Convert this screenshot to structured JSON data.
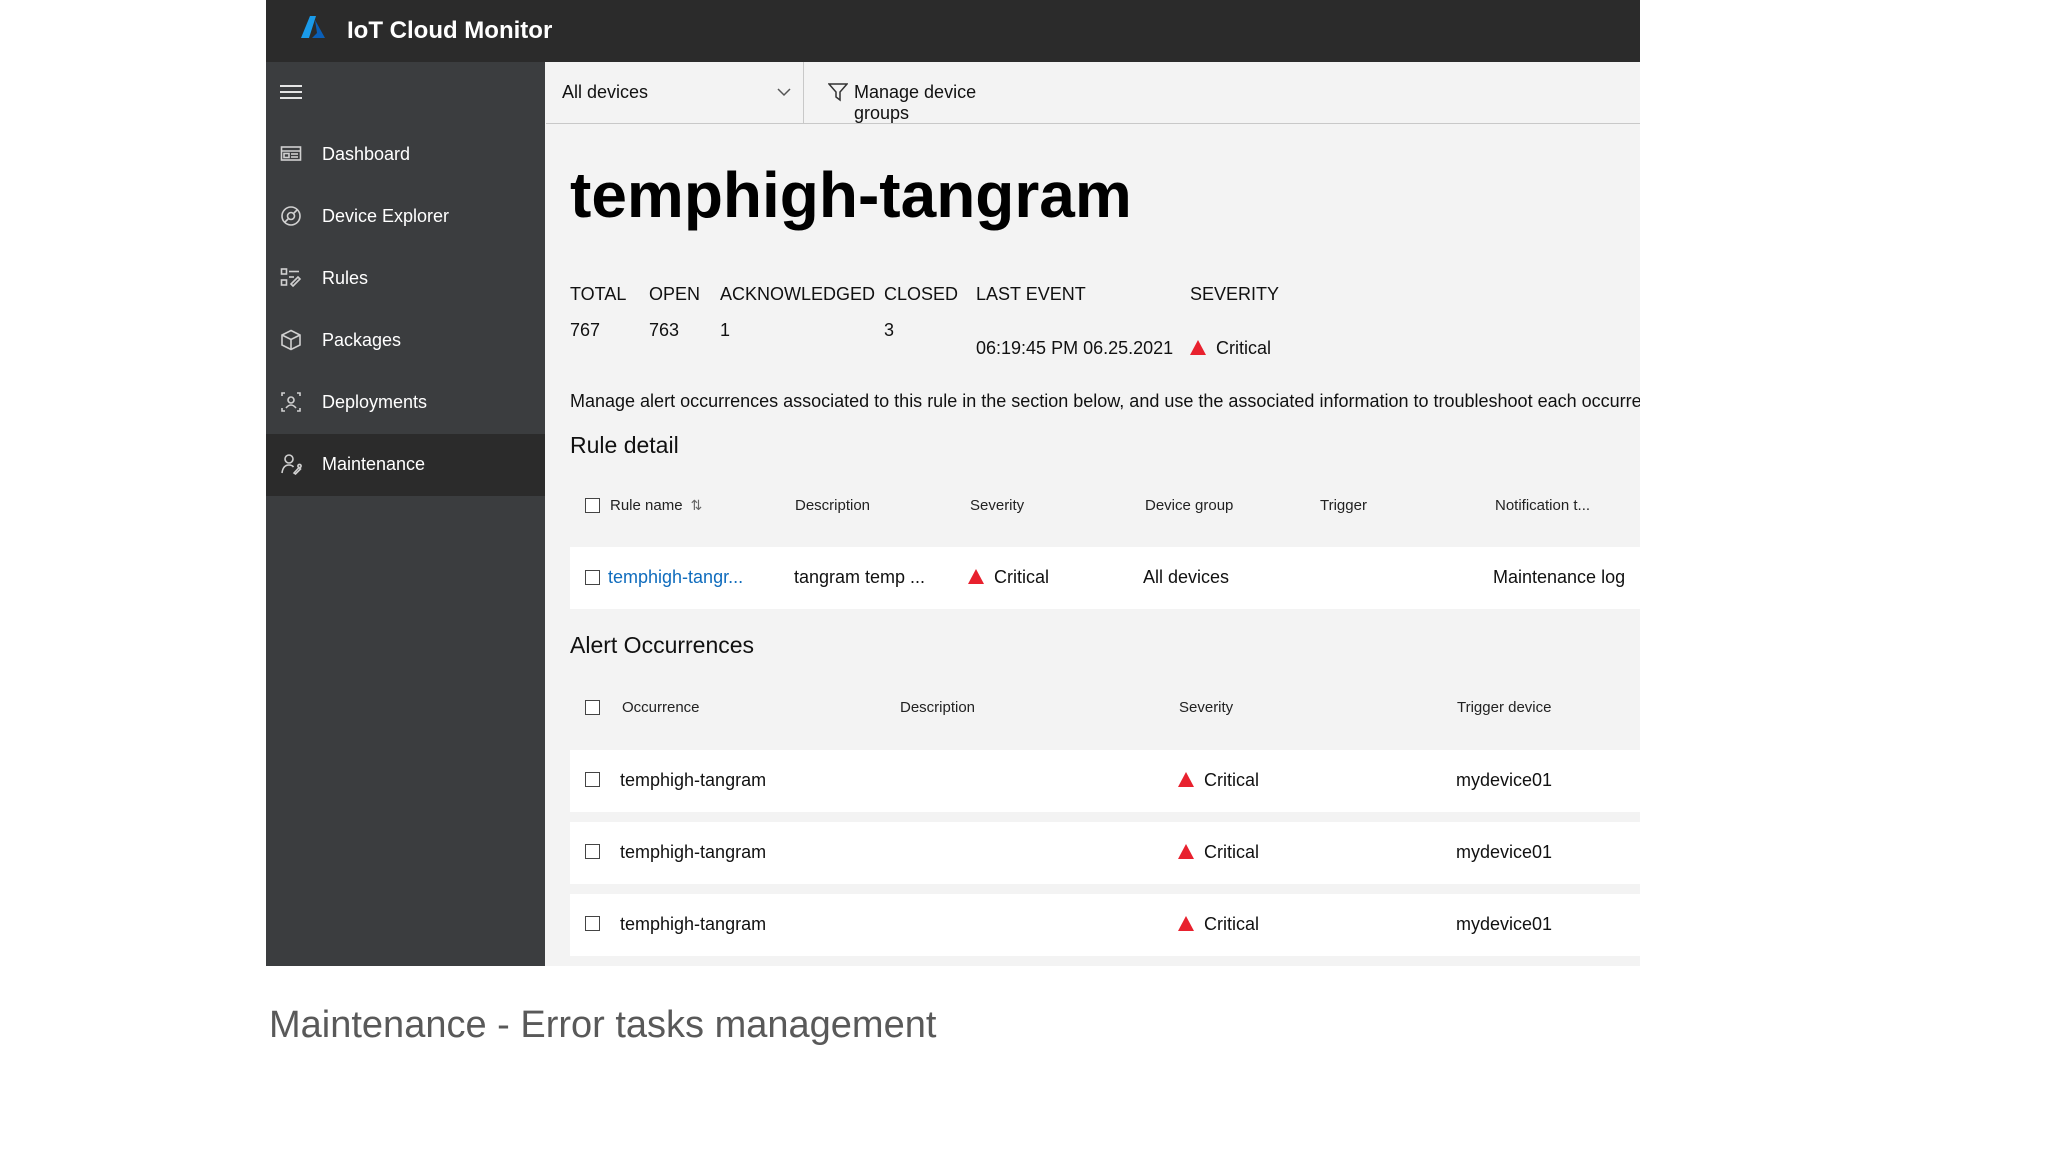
{
  "app": {
    "title": "IoT Cloud Monitor",
    "colors": {
      "topbar": "#2b2b2b",
      "sidebar": "#3b3d3f",
      "accent": "#0f6cbd",
      "critical": "#e8212e"
    }
  },
  "sidebar": {
    "items": [
      {
        "label": "Dashboard",
        "icon": "dashboard-icon"
      },
      {
        "label": "Device Explorer",
        "icon": "device-explorer-icon"
      },
      {
        "label": "Rules",
        "icon": "rules-icon"
      },
      {
        "label": "Packages",
        "icon": "package-icon"
      },
      {
        "label": "Deployments",
        "icon": "deployments-icon"
      },
      {
        "label": "Maintenance",
        "icon": "maintenance-icon",
        "active": true
      }
    ]
  },
  "toolbar": {
    "device_filter": "All devices",
    "manage_groups": "Manage device groups"
  },
  "page": {
    "title": "temphigh-tangram",
    "stats": {
      "total_label": "TOTAL",
      "total": "767",
      "open_label": "OPEN",
      "open": "763",
      "ack_label": "ACKNOWLEDGED",
      "ack": "1",
      "closed_label": "CLOSED",
      "closed": "3",
      "last_event_label": "LAST EVENT",
      "last_event": "06:19:45 PM 06.25.2021",
      "severity_label": "SEVERITY",
      "severity": "Critical"
    },
    "description": "Manage alert occurrences associated to this rule in the section below, and use the associated information to troubleshoot each occurrence"
  },
  "rule_detail": {
    "title": "Rule detail",
    "headers": [
      "Rule name",
      "Description",
      "Severity",
      "Device group",
      "Trigger",
      "Notification t..."
    ],
    "row": {
      "rule_name": "temphigh-tangr...",
      "description": "tangram temp ...",
      "severity": "Critical",
      "device_group": "All devices",
      "trigger": "",
      "notification": "Maintenance log"
    }
  },
  "alert_occurrences": {
    "title": "Alert Occurrences",
    "headers": [
      "Occurrence",
      "Description",
      "Severity",
      "Trigger device"
    ],
    "rows": [
      {
        "occurrence": "temphigh-tangram",
        "description": "",
        "severity": "Critical",
        "trigger_device": "mydevice01"
      },
      {
        "occurrence": "temphigh-tangram",
        "description": "",
        "severity": "Critical",
        "trigger_device": "mydevice01"
      },
      {
        "occurrence": "temphigh-tangram",
        "description": "",
        "severity": "Critical",
        "trigger_device": "mydevice01"
      }
    ]
  },
  "caption": "Maintenance - Error tasks management"
}
